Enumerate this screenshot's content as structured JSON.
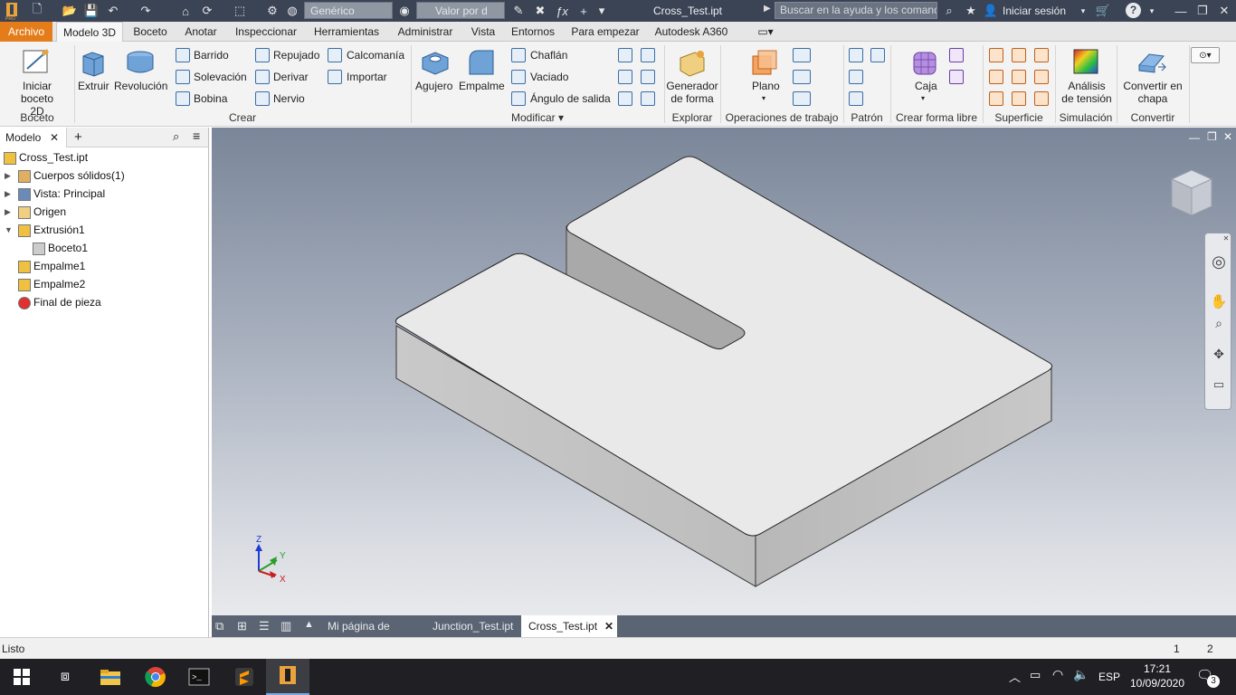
{
  "titlebar": {
    "material": "Genérico",
    "appearance": "Valor por d",
    "document_title": "Cross_Test.ipt",
    "search_placeholder": "Buscar en la ayuda y los comand",
    "signin": "Iniciar sesión",
    "help": "?"
  },
  "tabs": [
    "Archivo",
    "Modelo 3D",
    "Boceto",
    "Anotar",
    "Inspeccionar",
    "Herramientas",
    "Administrar",
    "Vista",
    "Entornos",
    "Para empezar",
    "Autodesk A360"
  ],
  "active_tab": "Modelo 3D",
  "ribbon": {
    "boceto": {
      "start_sketch": "Iniciar",
      "start_sketch2": "boceto 2D",
      "group": "Boceto"
    },
    "crear": {
      "extrude": "Extruir",
      "revolve": "Revolución",
      "sweep": "Barrido",
      "loft": "Solevación",
      "coil": "Bobina",
      "emboss": "Repujado",
      "derive": "Derivar",
      "rib": "Nervio",
      "decal": "Calcomanía",
      "import": "Importar",
      "group": "Crear"
    },
    "modificar": {
      "hole": "Agujero",
      "fillet": "Empalme",
      "chamfer": "Chaflán",
      "shell": "Vaciado",
      "draft": "Ángulo de salida",
      "group": "Modificar ▾"
    },
    "explorar": {
      "shape_gen": "Generador",
      "shape_gen2": "de forma",
      "group": "Explorar"
    },
    "operaciones": {
      "plane": "Plano",
      "group": "Operaciones de trabajo"
    },
    "patron": {
      "group": "Patrón"
    },
    "forma_libre": {
      "box": "Caja",
      "group": "Crear forma libre"
    },
    "superficie": {
      "group": "Superficie"
    },
    "simulacion": {
      "stress": "Análisis",
      "stress2": "de tensión",
      "group": "Simulación"
    },
    "convertir": {
      "sheet": "Convertir en",
      "sheet2": "chapa",
      "group": "Convertir"
    }
  },
  "browser": {
    "tab": "Modelo",
    "add": "+",
    "tree": [
      {
        "label": "Cross_Test.ipt",
        "indent": 0,
        "icon": "part-icon"
      },
      {
        "label": "Cuerpos sólidos(1)",
        "indent": 1,
        "icon": "solid-bodies-icon"
      },
      {
        "label": "Vista: Principal",
        "indent": 1,
        "icon": "view-icon"
      },
      {
        "label": "Origen",
        "indent": 1,
        "icon": "folder-icon"
      },
      {
        "label": "Extrusión1",
        "indent": 1,
        "icon": "extrude-icon"
      },
      {
        "label": "Boceto1",
        "indent": 2,
        "icon": "sketch-icon"
      },
      {
        "label": "Empalme1",
        "indent": 1,
        "icon": "fillet-icon"
      },
      {
        "label": "Empalme2",
        "indent": 1,
        "icon": "fillet-icon"
      },
      {
        "label": "Final de pieza",
        "indent": 1,
        "icon": "end-of-part-icon"
      }
    ]
  },
  "triad": {
    "z": "Z",
    "y": "Y",
    "x": "X"
  },
  "doc_tabs": [
    {
      "label": "Mi página de inic..."
    },
    {
      "label": "Junction_Test.ipt"
    },
    {
      "label": "Cross_Test.ipt",
      "active": true
    }
  ],
  "status": {
    "text": "Listo",
    "num1": "1",
    "num2": "2"
  },
  "taskbar": {
    "lang": "ESP",
    "time": "17:21",
    "date": "10/09/2020",
    "notifications": "3"
  },
  "colors": {
    "accent": "#e57c1a",
    "titlebar": "#3b4455",
    "viewport_top": "#7a8699"
  }
}
